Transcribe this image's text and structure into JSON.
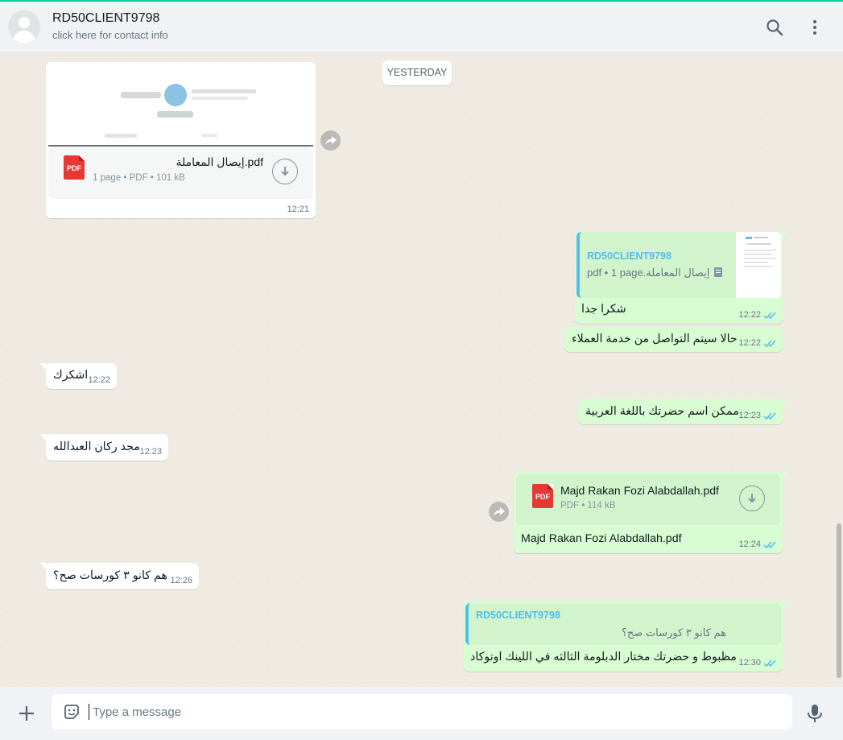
{
  "header": {
    "contact_name": "RD50CLIENT9798",
    "contact_sub": "click here for contact info",
    "icons": [
      "search-icon",
      "menu-icon"
    ]
  },
  "chat": {
    "date_label": "YESTERDAY",
    "m1": {
      "doc_name": "إيصال المعاملة.pdf",
      "doc_meta": "1 page • PDF • 101 kB",
      "pdf_label": "PDF",
      "time": "12:21"
    },
    "m2": {
      "quote_name": "RD50CLIENT9798",
      "quote_text": "pdf • 1 page.إيصال المعاملة",
      "text": "شكرا جدا",
      "time": "12:22"
    },
    "m3": {
      "text": "حالا سيتم التواصل من خدمة العملاء",
      "time": "12:22"
    },
    "m4": {
      "text": "اشكرك",
      "time": "12:22"
    },
    "m5": {
      "text": "ممكن اسم حضرتك باللغة العربية",
      "time": "12:23"
    },
    "m6": {
      "text": "مجد ركان العبدالله",
      "time": "12:23"
    },
    "m7": {
      "doc_name": "Majd Rakan Fozi Alabdallah.pdf",
      "doc_meta": "PDF • 114 kB",
      "pdf_label": "PDF",
      "caption": "Majd Rakan Fozi Alabdallah.pdf",
      "time": "12:24"
    },
    "m8": {
      "text": "هم كانو ٣ كورسات صح؟",
      "time": "12:26"
    },
    "m9": {
      "quote_name": "RD50CLIENT9798",
      "quote_text": "هم كانو ٣ كورسات صح؟",
      "text": "مظبوط و حضرتك مختار الدبلومة الثالثه في اللينك اوتوكاد",
      "time": "12:30"
    }
  },
  "composer": {
    "placeholder": "Type a message"
  },
  "colors": {
    "outgoing": "#d9fdd3",
    "incoming": "#ffffff",
    "read_ticks": "#53bdeb",
    "pdf": "#e53935"
  }
}
